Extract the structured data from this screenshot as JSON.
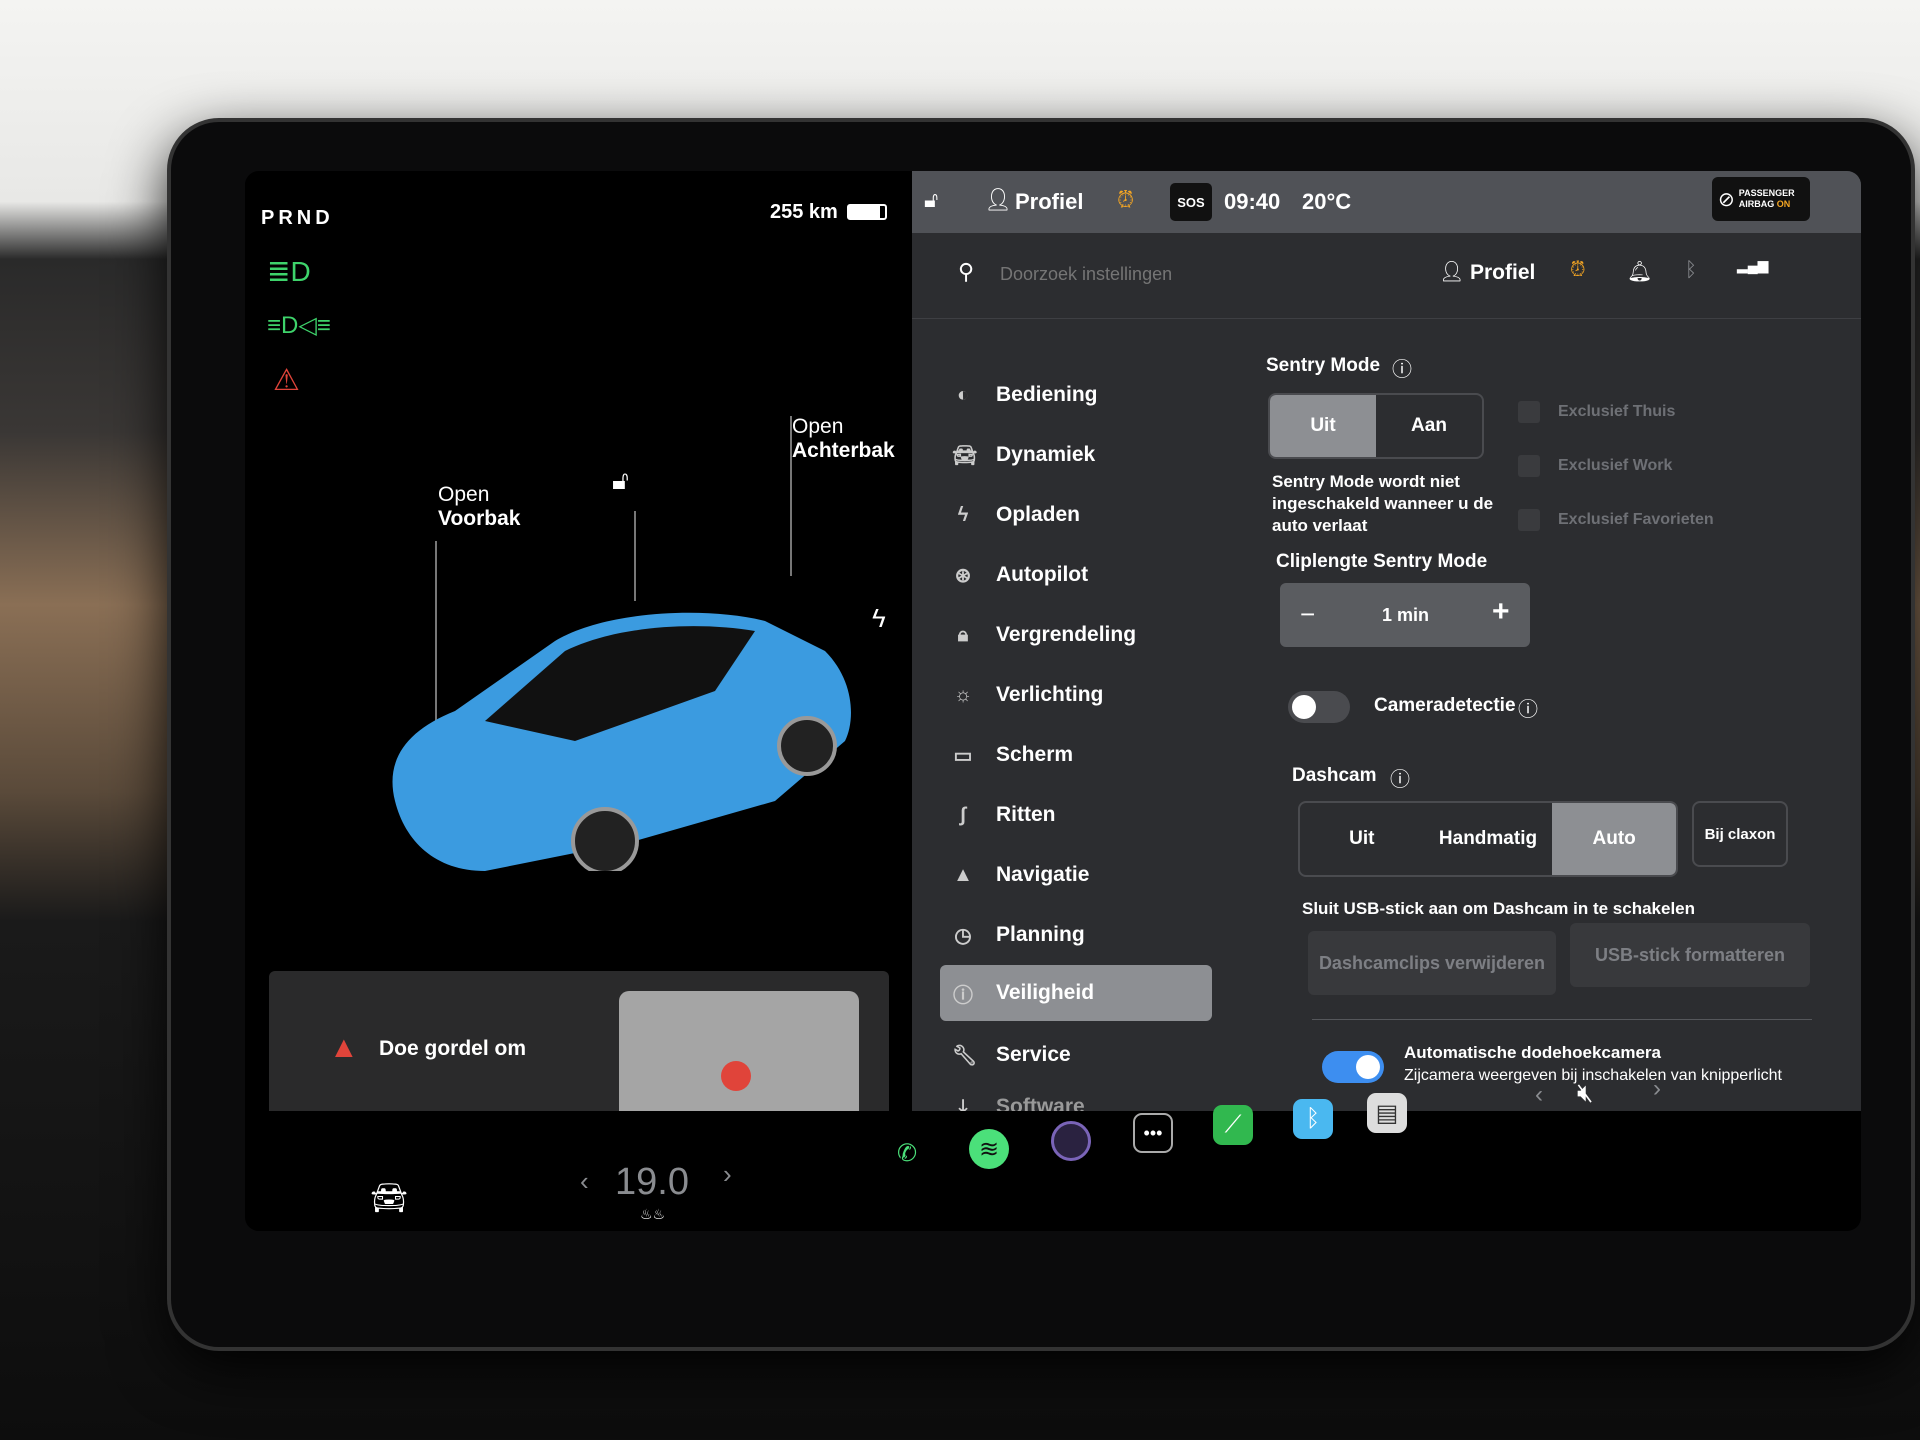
{
  "status": {
    "gear": "PRND",
    "range": "255 km",
    "battery_level": 0.85
  },
  "car_view": {
    "frunk_label": "Open",
    "frunk_name": "Voorbak",
    "trunk_label": "Open",
    "trunk_name": "Achterbak",
    "car_color": "#3b9be0"
  },
  "alert": {
    "text": "Doe gordel om",
    "color": "#e0443a"
  },
  "topbar": {
    "profile": "Profiel",
    "sos": "SOS",
    "time": "09:40",
    "temperature": "20°C",
    "airbag_line1": "PASSENGER",
    "airbag_line2": "AIRBAG",
    "airbag_state": "ON"
  },
  "search": {
    "placeholder": "Doorzoek instellingen",
    "profile": "Profiel"
  },
  "menu": [
    {
      "label": "Bediening",
      "icon": "toggle-icon"
    },
    {
      "label": "Dynamiek",
      "icon": "car-icon"
    },
    {
      "label": "Opladen",
      "icon": "bolt-icon"
    },
    {
      "label": "Autopilot",
      "icon": "steering-wheel-icon"
    },
    {
      "label": "Vergrendeling",
      "icon": "lock-icon"
    },
    {
      "label": "Verlichting",
      "icon": "sun-icon"
    },
    {
      "label": "Scherm",
      "icon": "display-icon"
    },
    {
      "label": "Ritten",
      "icon": "trips-icon"
    },
    {
      "label": "Navigatie",
      "icon": "navigation-icon"
    },
    {
      "label": "Planning",
      "icon": "clock-icon"
    },
    {
      "label": "Veiligheid",
      "icon": "shield-icon",
      "selected": true
    },
    {
      "label": "Service",
      "icon": "wrench-icon"
    },
    {
      "label": "Software",
      "icon": "download-icon"
    }
  ],
  "sentry": {
    "title": "Sentry Mode",
    "options": [
      "Uit",
      "Aan"
    ],
    "selected": "Uit",
    "note": "Sentry Mode wordt niet ingeschakeld wanneer u de auto verlaat",
    "exclusions": [
      "Exclusief Thuis",
      "Exclusief Work",
      "Exclusief Favorieten"
    ],
    "clip_title": "Cliplengte Sentry Mode",
    "clip_value": "1 min",
    "minus": "−",
    "plus": "+"
  },
  "camera_detection": {
    "label": "Cameradetectie",
    "on": false
  },
  "dashcam": {
    "title": "Dashcam",
    "options": [
      "Uit",
      "Handmatig",
      "Auto"
    ],
    "selected": "Auto",
    "horn_option": "Bij claxon",
    "usb_note": "Sluit USB-stick aan om Dashcam in te schakelen",
    "delete_button": "Dashcamclips verwijderen",
    "format_button": "USB-stick formatteren"
  },
  "blindspot": {
    "title": "Automatische dodehoekcamera",
    "subtitle": "Zijcamera weergeven bij inschakelen van knipperlicht",
    "on": true,
    "accent": "#3d8ef0"
  },
  "climate": {
    "temperature": "19.0",
    "prev": "‹",
    "next": "›"
  },
  "media": {
    "prev": "‹",
    "next": "›"
  }
}
